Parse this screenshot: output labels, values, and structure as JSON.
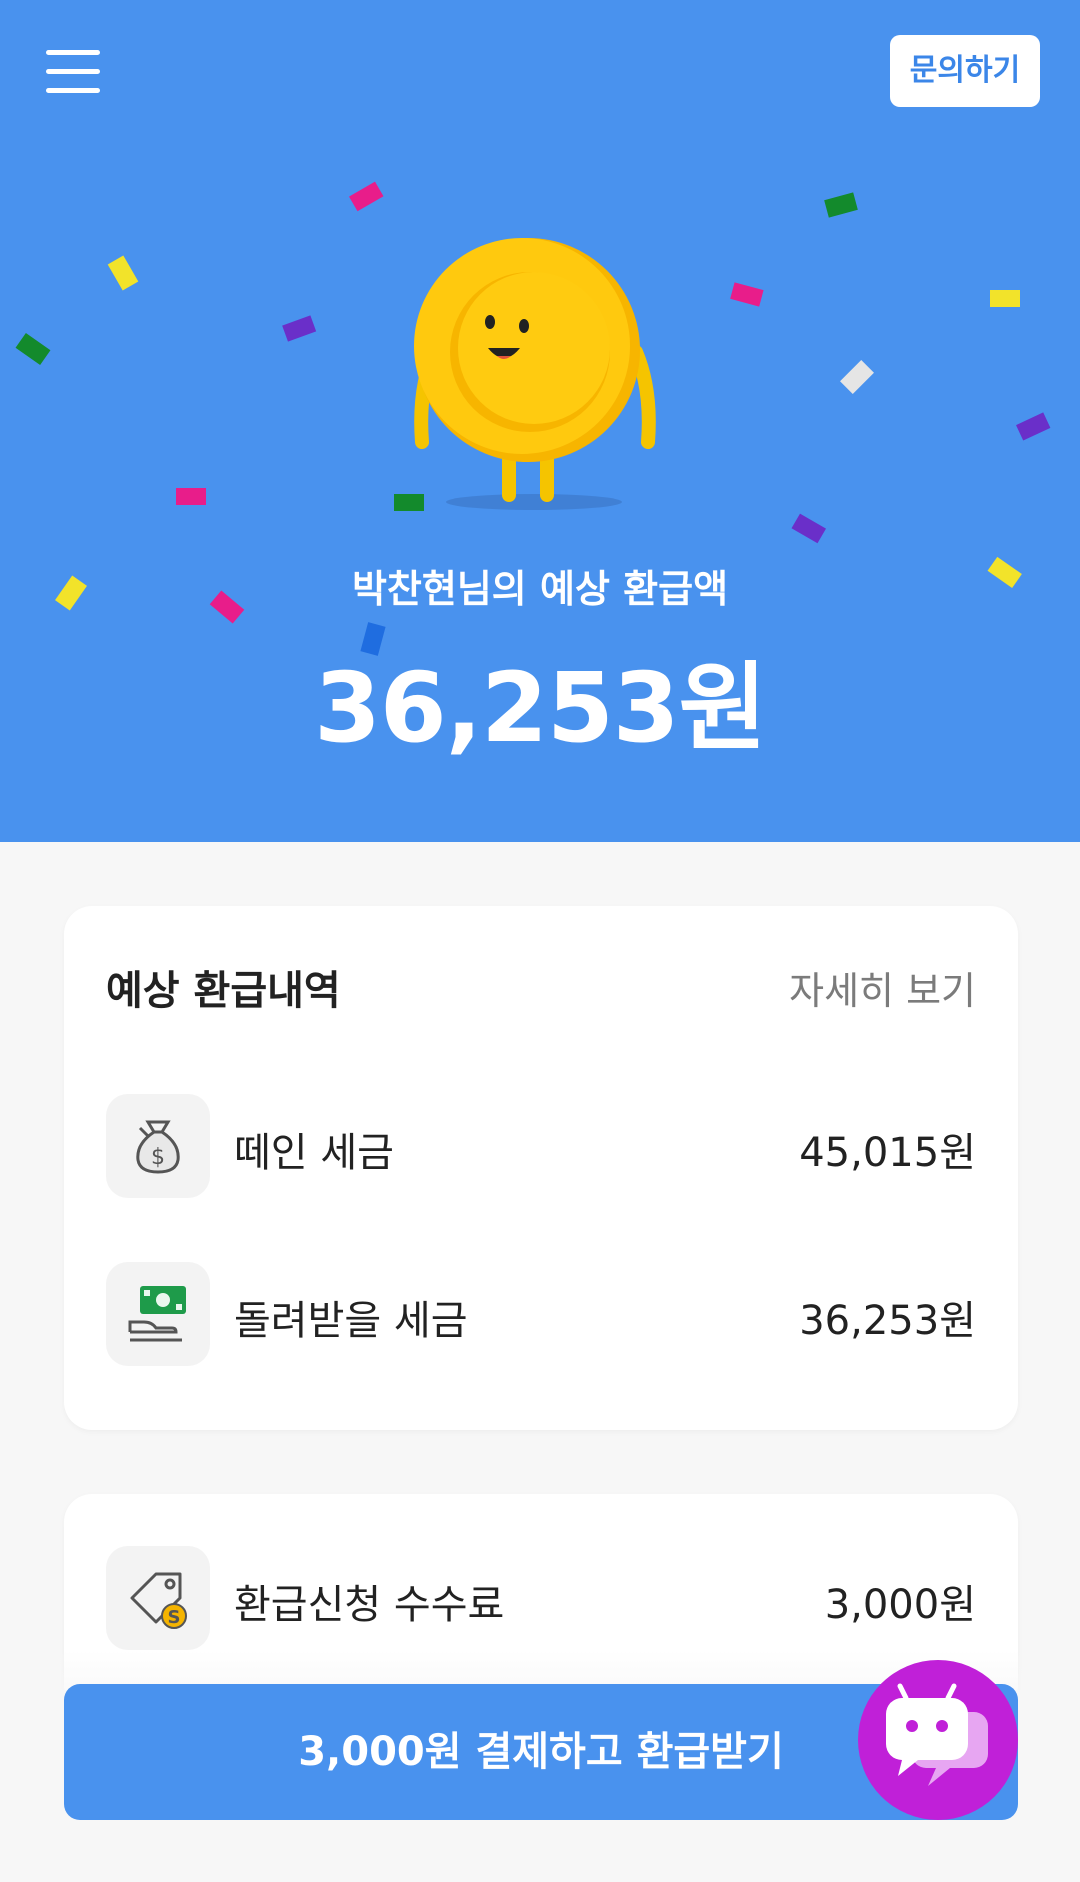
{
  "header": {
    "menu_icon": "hamburger-menu-icon",
    "inquiry_label": "문의하기"
  },
  "hero": {
    "subtitle": "박찬현님의 예상 환급액",
    "amount": "36,253원",
    "mascot_icon": "coin-mascot-icon",
    "background_color": "#4992ee"
  },
  "refund_card": {
    "title": "예상 환급내역",
    "detail_link": "자세히 보기",
    "rows": [
      {
        "label": "떼인 세금",
        "value": "45,015원",
        "icon": "money-bag-icon"
      },
      {
        "label": "돌려받을 세금",
        "value": "36,253원",
        "icon": "cash-hand-icon"
      }
    ]
  },
  "fee_card": {
    "rows": [
      {
        "label": "환급신청 수수료",
        "value": "3,000원",
        "icon": "price-tag-coin-icon"
      }
    ]
  },
  "cta": {
    "label": "3,000원 결제하고 환급받기"
  },
  "chatbot": {
    "icon": "chatbot-icon",
    "color": "#c020d8"
  }
}
